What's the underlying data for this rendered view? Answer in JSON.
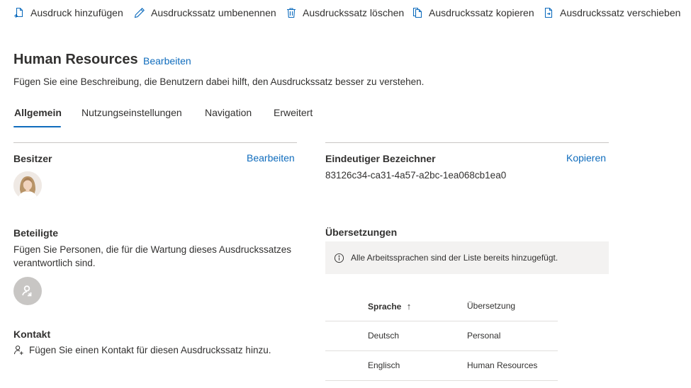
{
  "toolbar": {
    "add_print": "Ausdruck hinzufügen",
    "rename_set": "Ausdruckssatz umbenennen",
    "delete_set": "Ausdruckssatz löschen",
    "copy_set": "Ausdruckssatz kopieren",
    "move_set": "Ausdruckssatz verschieben"
  },
  "header": {
    "title": "Human Resources",
    "edit_label": "Bearbeiten",
    "description": "Fügen Sie eine Beschreibung, die Benutzern dabei hilft, den Ausdruckssatz besser zu verstehen."
  },
  "tabs": [
    {
      "label": "Allgemein"
    },
    {
      "label": "Nutzungseinstellungen"
    },
    {
      "label": "Navigation"
    },
    {
      "label": "Erweitert"
    }
  ],
  "owner": {
    "label": "Besitzer",
    "edit_label": "Bearbeiten"
  },
  "identifier": {
    "label": "Eindeutiger Bezeichner",
    "copy_label": "Kopieren",
    "value": "83126c34-ca31-4a57-a2bc-1ea068cb1ea0"
  },
  "stakeholders": {
    "label": "Beteiligte",
    "text_line1": "Fügen Sie Personen, die für die Wartung dieses Ausdruckssatzes",
    "text_line2": "verantwortlich sind."
  },
  "translations": {
    "label": "Übersetzungen",
    "info": "Alle Arbeitssprachen sind der Liste bereits hinzugefügt.",
    "columns": {
      "language": "Sprache",
      "translation": "Übersetzung"
    },
    "sort_indicator": "↑",
    "rows": [
      {
        "language": "Deutsch",
        "translation": "Personal"
      },
      {
        "language": "Englisch",
        "translation": "Human Resources"
      }
    ]
  },
  "contact": {
    "label": "Kontakt",
    "add_text": "Fügen Sie einen Kontakt für diesen Ausdruckssatz hinzu."
  },
  "colors": {
    "accent": "#0f6cbd",
    "text": "#323130",
    "divider": "#c8c6c4",
    "info_bg": "#f3f2f1"
  },
  "icons": {
    "add_print": "add-document-icon",
    "rename": "pencil-icon",
    "delete": "trash-icon",
    "copy": "copy-icon",
    "move": "move-document-icon",
    "info": "info-icon",
    "add_contact": "add-person-icon",
    "placeholder_avatar": "person-icon"
  }
}
